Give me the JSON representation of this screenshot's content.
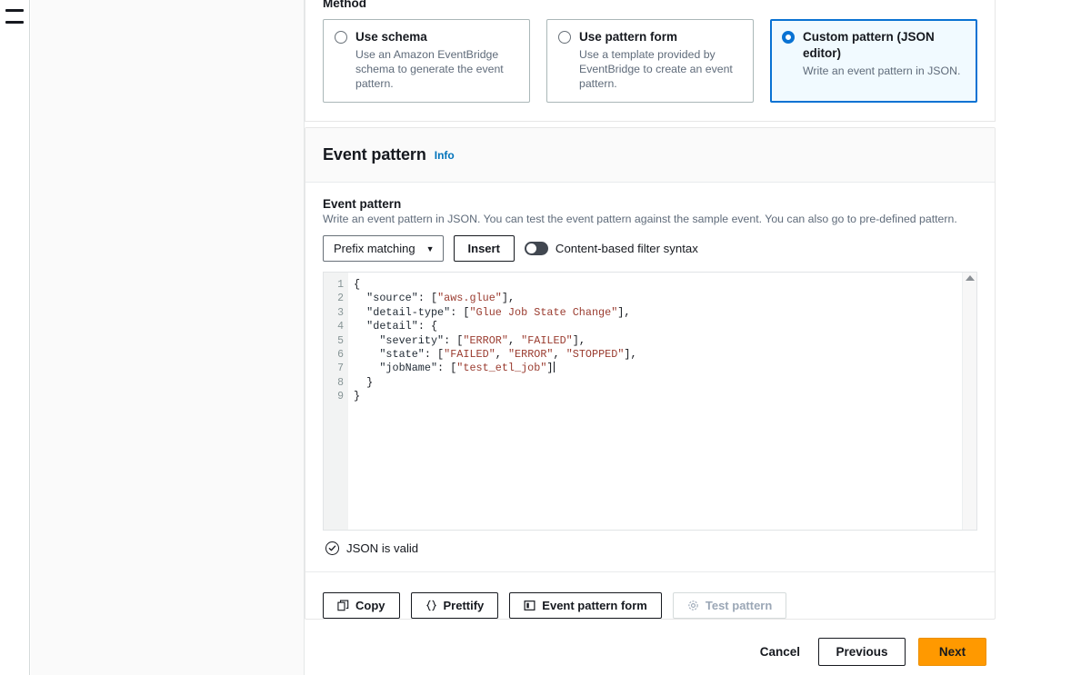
{
  "nav": {
    "menu_icon": "hamburger-menu-icon"
  },
  "method": {
    "label": "Method",
    "cards": [
      {
        "title": "Use schema",
        "description": "Use an Amazon EventBridge schema to generate the event pattern.",
        "selected": false
      },
      {
        "title": "Use pattern form",
        "description": "Use a template provided by EventBridge to create an event pattern.",
        "selected": false
      },
      {
        "title": "Custom pattern (JSON editor)",
        "description": "Write an event pattern in JSON.",
        "selected": true
      }
    ]
  },
  "event_pattern": {
    "section_title": "Event pattern",
    "info_label": "Info",
    "field_label": "Event pattern",
    "field_hint": "Write an event pattern in JSON. You can test the event pattern against the sample event. You can also go to pre-defined pattern.",
    "matcher_select": {
      "value": "Prefix matching",
      "caret_icon": "chevron-down-icon"
    },
    "insert_label": "Insert",
    "filter_toggle": {
      "label": "Content-based filter syntax",
      "enabled": false
    },
    "editor": {
      "line_numbers": [
        "1",
        "2",
        "3",
        "4",
        "5",
        "6",
        "7",
        "8",
        "9"
      ],
      "lines": [
        "{",
        "  \"source\": [\"aws.glue\"],",
        "  \"detail-type\": [\"Glue Job State Change\"],",
        "  \"detail\": {",
        "    \"severity\": [\"ERROR\", \"FAILED\"],",
        "    \"state\": [\"FAILED\", \"ERROR\", \"STOPPED\"],",
        "    \"jobName\": [\"test_etl_job\"]",
        "  }",
        "}"
      ],
      "scroll_up_icon": "scroll-up-arrow-icon"
    },
    "status": {
      "icon": "check-circle-icon",
      "text": "JSON is valid"
    },
    "actions": [
      {
        "label": "Copy",
        "icon": "copy-icon",
        "disabled": false
      },
      {
        "label": "Prettify",
        "icon": "braces-icon",
        "disabled": false
      },
      {
        "label": "Event pattern form",
        "icon": "panel-icon",
        "disabled": false
      },
      {
        "label": "Test pattern",
        "icon": "gear-icon",
        "disabled": true
      }
    ]
  },
  "footer": {
    "cancel_label": "Cancel",
    "previous_label": "Previous",
    "next_label": "Next"
  },
  "colors": {
    "accent_blue": "#0972d3",
    "info_link": "#0073bb",
    "selected_card_bg": "#f1faff",
    "next_button": "#f90",
    "string_token": "#9a3b2f",
    "editor_bg": "#f2f3f3"
  }
}
